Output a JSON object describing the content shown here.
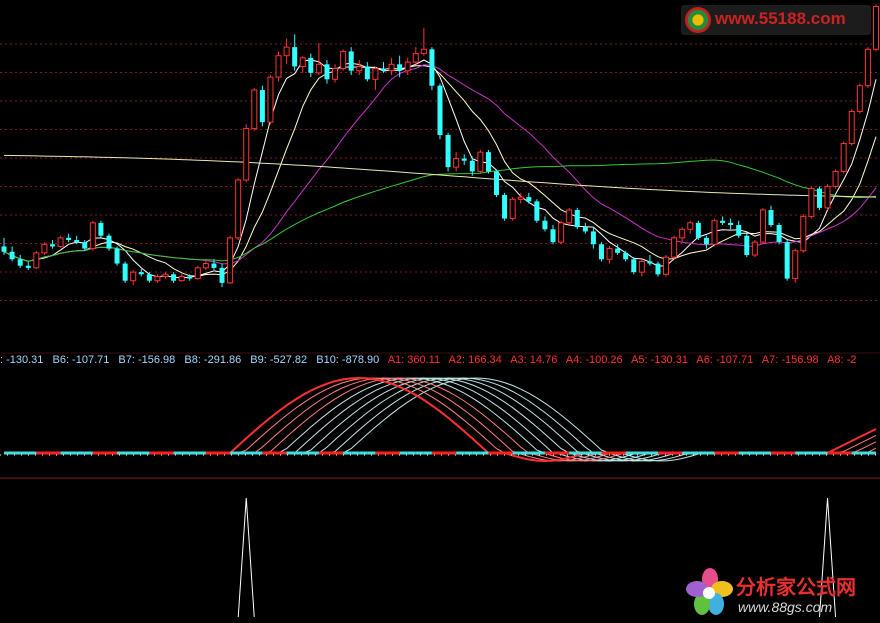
{
  "chart_data": [
    {
      "type": "candlestick",
      "panel": "price",
      "candles": [
        [
          4.0,
          4.8,
          3.2,
          3.5
        ],
        [
          3.5,
          4.0,
          2.6,
          2.8
        ],
        [
          2.8,
          3.2,
          2.0,
          2.2
        ],
        [
          2.2,
          2.6,
          1.8,
          2.0
        ],
        [
          2.0,
          3.6,
          1.9,
          3.4
        ],
        [
          3.4,
          4.4,
          3.2,
          4.2
        ],
        [
          4.2,
          4.6,
          3.8,
          4.0
        ],
        [
          4.0,
          5.0,
          3.9,
          4.8
        ],
        [
          4.8,
          5.2,
          4.4,
          4.6
        ],
        [
          4.6,
          5.0,
          4.2,
          4.4
        ],
        [
          4.4,
          4.6,
          3.6,
          3.8
        ],
        [
          3.8,
          6.4,
          3.6,
          6.2
        ],
        [
          6.2,
          6.4,
          4.8,
          5.0
        ],
        [
          5.0,
          5.2,
          3.6,
          3.8
        ],
        [
          3.8,
          4.0,
          2.2,
          2.4
        ],
        [
          2.4,
          2.6,
          0.6,
          0.8
        ],
        [
          0.8,
          1.8,
          0.4,
          1.6
        ],
        [
          1.6,
          1.9,
          1.2,
          1.4
        ],
        [
          1.4,
          1.6,
          0.6,
          0.8
        ],
        [
          0.8,
          1.4,
          0.6,
          1.2
        ],
        [
          1.2,
          1.6,
          1.0,
          1.4
        ],
        [
          1.4,
          1.6,
          0.6,
          0.8
        ],
        [
          0.8,
          1.4,
          0.7,
          1.2
        ],
        [
          1.2,
          1.4,
          0.8,
          1.0
        ],
        [
          1.0,
          2.2,
          0.9,
          2.0
        ],
        [
          2.0,
          2.6,
          1.8,
          2.4
        ],
        [
          2.4,
          2.8,
          1.8,
          2.0
        ],
        [
          2.0,
          2.4,
          0.2,
          0.6
        ],
        [
          0.6,
          5.0,
          0.5,
          4.8
        ],
        [
          4.8,
          10.4,
          4.6,
          10.2
        ],
        [
          10.2,
          15.4,
          10.0,
          15.0
        ],
        [
          15.0,
          18.8,
          14.8,
          18.6
        ],
        [
          18.6,
          19.0,
          15.2,
          15.6
        ],
        [
          15.6,
          20.0,
          15.4,
          19.8
        ],
        [
          19.8,
          22.2,
          19.4,
          21.8
        ],
        [
          21.8,
          23.4,
          21.0,
          22.6
        ],
        [
          22.6,
          23.8,
          20.4,
          20.8
        ],
        [
          20.8,
          21.8,
          20.2,
          21.6
        ],
        [
          21.6,
          22.0,
          19.8,
          20.2
        ],
        [
          20.2,
          23.0,
          20.0,
          21.0
        ],
        [
          21.0,
          21.4,
          19.2,
          19.6
        ],
        [
          19.6,
          21.0,
          19.3,
          20.6
        ],
        [
          20.6,
          22.4,
          20.4,
          22.2
        ],
        [
          22.2,
          22.6,
          20.0,
          20.4
        ],
        [
          20.4,
          21.4,
          20.0,
          20.8
        ],
        [
          20.8,
          21.2,
          19.4,
          19.6
        ],
        [
          19.6,
          20.8,
          18.6,
          20.6
        ],
        [
          20.6,
          21.2,
          20.2,
          20.4
        ],
        [
          20.4,
          21.6,
          20.0,
          21.0
        ],
        [
          21.0,
          21.8,
          19.8,
          20.4
        ],
        [
          20.4,
          21.6,
          20.0,
          21.2
        ],
        [
          21.2,
          22.6,
          21.0,
          22.0
        ],
        [
          22.0,
          24.4,
          21.8,
          22.4
        ],
        [
          22.4,
          22.6,
          18.6,
          19.0
        ],
        [
          19.0,
          19.2,
          14.0,
          14.4
        ],
        [
          14.4,
          14.6,
          11.0,
          11.4
        ],
        [
          11.4,
          12.8,
          11.0,
          12.2
        ],
        [
          12.2,
          12.6,
          11.6,
          12.0
        ],
        [
          12.0,
          12.4,
          10.6,
          11.0
        ],
        [
          11.0,
          13.0,
          10.8,
          12.8
        ],
        [
          12.8,
          13.0,
          10.8,
          11.0
        ],
        [
          11.0,
          11.2,
          8.6,
          8.8
        ],
        [
          8.8,
          9.0,
          6.4,
          6.6
        ],
        [
          6.6,
          8.6,
          6.4,
          8.4
        ],
        [
          8.4,
          9.0,
          8.0,
          8.6
        ],
        [
          8.6,
          9.0,
          8.0,
          8.2
        ],
        [
          8.2,
          8.4,
          6.2,
          6.4
        ],
        [
          6.4,
          6.8,
          5.4,
          5.6
        ],
        [
          5.6,
          6.0,
          4.2,
          4.4
        ],
        [
          4.4,
          6.4,
          4.2,
          6.2
        ],
        [
          6.2,
          7.6,
          6.0,
          7.4
        ],
        [
          7.4,
          7.6,
          5.6,
          5.8
        ],
        [
          5.8,
          6.2,
          5.2,
          5.4
        ],
        [
          5.4,
          5.8,
          3.8,
          4.2
        ],
        [
          4.2,
          4.4,
          2.6,
          2.8
        ],
        [
          2.8,
          4.0,
          2.4,
          3.8
        ],
        [
          3.8,
          4.2,
          3.2,
          3.4
        ],
        [
          3.4,
          3.6,
          2.6,
          2.8
        ],
        [
          2.8,
          3.0,
          1.4,
          1.6
        ],
        [
          1.6,
          2.8,
          1.2,
          2.6
        ],
        [
          2.6,
          3.2,
          2.2,
          2.4
        ],
        [
          2.4,
          2.6,
          1.2,
          1.4
        ],
        [
          1.4,
          3.2,
          1.2,
          3.0
        ],
        [
          3.0,
          5.0,
          2.8,
          4.8
        ],
        [
          4.8,
          5.8,
          4.4,
          5.6
        ],
        [
          5.6,
          6.4,
          5.2,
          6.2
        ],
        [
          6.2,
          6.4,
          4.6,
          4.8
        ],
        [
          4.8,
          5.0,
          3.8,
          4.2
        ],
        [
          4.2,
          6.6,
          4.0,
          6.4
        ],
        [
          6.4,
          6.8,
          6.0,
          6.2
        ],
        [
          6.2,
          6.6,
          5.6,
          6.0
        ],
        [
          6.0,
          6.4,
          4.8,
          5.0
        ],
        [
          5.0,
          5.2,
          3.0,
          3.2
        ],
        [
          3.2,
          4.6,
          3.0,
          4.4
        ],
        [
          4.4,
          7.6,
          4.2,
          7.4
        ],
        [
          7.4,
          7.8,
          5.8,
          6.0
        ],
        [
          6.0,
          6.2,
          4.2,
          4.4
        ],
        [
          4.4,
          4.6,
          0.8,
          1.0
        ],
        [
          1.0,
          3.8,
          0.6,
          3.6
        ],
        [
          3.6,
          7.0,
          3.4,
          6.8
        ],
        [
          6.8,
          9.6,
          6.6,
          9.4
        ],
        [
          9.4,
          9.6,
          7.4,
          7.6
        ],
        [
          7.6,
          9.8,
          7.4,
          9.6
        ],
        [
          9.6,
          11.2,
          9.4,
          11.0
        ],
        [
          11.0,
          13.8,
          10.8,
          13.6
        ],
        [
          13.6,
          16.8,
          13.4,
          16.6
        ],
        [
          16.6,
          19.2,
          16.4,
          19.0
        ],
        [
          19.0,
          22.6,
          18.8,
          22.4
        ],
        [
          22.4,
          26.6,
          22.2,
          26.4
        ]
      ]
    },
    {
      "type": "line",
      "panel": "indicator",
      "label_values": {
        "b_labels": [
          ": -130.31",
          "B6: -107.71",
          "B7: -156.98",
          "B8: -291.86",
          "B9: -527.82",
          "B10: -878.90"
        ],
        "a_labels": [
          "A1: 360.11",
          "A2: 166.34",
          "A3: 14.76",
          "A4: -100.26",
          "A5: -130.31",
          "A6: -107.71",
          "A7: -156.98",
          "A8: -2"
        ]
      },
      "colors": {
        "b_label": "#9fd7ff",
        "a_label": "#ff3030",
        "up": "#ff2020",
        "down": "#40e0e0"
      }
    },
    {
      "type": "line",
      "panel": "signal",
      "description_free": true,
      "spikes": [
        30,
        102
      ]
    }
  ],
  "watermarks": {
    "top": "www.55188.com",
    "bottom_cn": "分析家公式网",
    "bottom_url": "www.88gs.com"
  },
  "colors": {
    "up_candle": "#ff3333",
    "down_candle": "#33ffff",
    "grid": "#7a1e1e",
    "ma5": "#ffffff",
    "ma10": "#ffffcc",
    "ma20": "#cc33cc",
    "ma60": "#33cc33",
    "ma120": "#e8e8b0"
  }
}
